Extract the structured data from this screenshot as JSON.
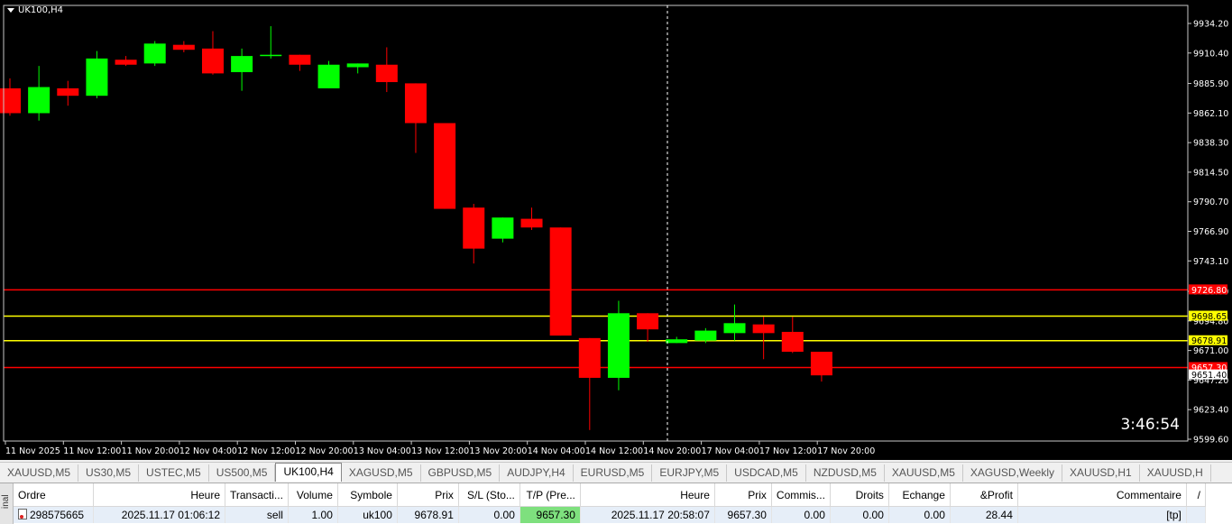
{
  "chart": {
    "symbol": "UK100,H4",
    "countdown": "3:46:54",
    "price_axis": [
      "9934.20",
      "9910.40",
      "9885.90",
      "9862.10",
      "9838.30",
      "9814.50",
      "9790.70",
      "9766.90",
      "9743.10",
      "9718.60",
      "9694.80",
      "9671.00",
      "9647.20",
      "9623.40",
      "9599.60"
    ],
    "price_labels": [
      {
        "price": 9719.8,
        "text": "9726.80",
        "bg": "#ff0000",
        "fg": "#ffffff",
        "color_line": "#ff0000"
      },
      {
        "price": 9698.65,
        "text": "9698.65",
        "bg": "#ffff00",
        "fg": "#000000",
        "color_line": "#ffff00"
      },
      {
        "price": 9678.91,
        "text": "9678.91",
        "bg": "#ffff00",
        "fg": "#000000",
        "color_line": "#ffff00"
      },
      {
        "price": 9657.3,
        "text": "9657.30",
        "bg": "#ff0000",
        "fg": "#ffffff",
        "color_line": "#ff0000"
      },
      {
        "price": 9651.4,
        "text": "9651.40",
        "bg": "#ffffff",
        "fg": "#000000",
        "color_line": ""
      }
    ],
    "time_axis": [
      "11 Nov 2025",
      "11 Nov 12:00",
      "11 Nov 20:00",
      "12 Nov 04:00",
      "12 Nov 12:00",
      "12 Nov 20:00",
      "13 Nov 04:00",
      "13 Nov 12:00",
      "13 Nov 20:00",
      "14 Nov 04:00",
      "14 Nov 12:00",
      "14 Nov 20:00",
      "17 Nov 04:00",
      "17 Nov 12:00",
      "17 Nov 20:00"
    ]
  },
  "chart_data": {
    "type": "candlestick",
    "ylim": [
      9595,
      9945
    ],
    "bull_color": "#00ff00",
    "bear_color": "#ff0000",
    "candles": [
      {
        "o": 9882,
        "h": 9890,
        "l": 9860,
        "c": 9862
      },
      {
        "o": 9862,
        "h": 9900,
        "l": 9856,
        "c": 9883
      },
      {
        "o": 9882,
        "h": 9888,
        "l": 9868,
        "c": 9876
      },
      {
        "o": 9876,
        "h": 9912,
        "l": 9874,
        "c": 9906
      },
      {
        "o": 9905,
        "h": 9908,
        "l": 9900,
        "c": 9901
      },
      {
        "o": 9902,
        "h": 9920,
        "l": 9900,
        "c": 9918
      },
      {
        "o": 9917,
        "h": 9920,
        "l": 9911,
        "c": 9913
      },
      {
        "o": 9914,
        "h": 9928,
        "l": 9893,
        "c": 9894
      },
      {
        "o": 9895,
        "h": 9914,
        "l": 9880,
        "c": 9908
      },
      {
        "o": 9908,
        "h": 9932,
        "l": 9906,
        "c": 9909
      },
      {
        "o": 9909,
        "h": 9909,
        "l": 9896,
        "c": 9901
      },
      {
        "o": 9882,
        "h": 9904,
        "l": 9882,
        "c": 9901
      },
      {
        "o": 9899,
        "h": 9902,
        "l": 9894,
        "c": 9902
      },
      {
        "o": 9901,
        "h": 9915,
        "l": 9879,
        "c": 9887
      },
      {
        "o": 9886,
        "h": 9886,
        "l": 9830,
        "c": 9854
      },
      {
        "o": 9854,
        "h": 9854,
        "l": 9785,
        "c": 9785
      },
      {
        "o": 9786,
        "h": 9789,
        "l": 9741,
        "c": 9753
      },
      {
        "o": 9761,
        "h": 9778,
        "l": 9758,
        "c": 9778
      },
      {
        "o": 9777,
        "h": 9786,
        "l": 9768,
        "c": 9770
      },
      {
        "o": 9770,
        "h": 9770,
        "l": 9683,
        "c": 9683
      },
      {
        "o": 9681,
        "h": 9681,
        "l": 9607,
        "c": 9649
      },
      {
        "o": 9649,
        "h": 9711,
        "l": 9639,
        "c": 9701
      },
      {
        "o": 9701,
        "h": 9701,
        "l": 9678,
        "c": 9688
      },
      {
        "o": 9677,
        "h": 9682,
        "l": 9677,
        "c": 9680
      },
      {
        "o": 9679,
        "h": 9689,
        "l": 9677,
        "c": 9687
      },
      {
        "o": 9685,
        "h": 9708,
        "l": 9679,
        "c": 9693
      },
      {
        "o": 9692,
        "h": 9698,
        "l": 9664,
        "c": 9685
      },
      {
        "o": 9686,
        "h": 9698,
        "l": 9669,
        "c": 9670
      },
      {
        "o": 9670,
        "h": 9670,
        "l": 9646,
        "c": 9651
      }
    ]
  },
  "tabs": [
    "XAUUSD,M5",
    "US30,M5",
    "USTEC,M5",
    "US500,M5",
    "UK100,H4",
    "XAGUSD,M5",
    "GBPUSD,M5",
    "AUDJPY,H4",
    "EURUSD,M5",
    "EURJPY,M5",
    "USDCAD,M5",
    "NZDUSD,M5",
    "XAUUSD,M5",
    "XAGUSD,Weekly",
    "XAUUSD,H1",
    "XAUUSD,H"
  ],
  "active_tab": 4,
  "terminal": {
    "side_label": "inal",
    "columns": [
      "Ordre",
      "Heure",
      "Transacti...",
      "Volume",
      "Symbole",
      "Prix",
      "S/L (Sto...",
      "T/P (Pre...",
      "Heure",
      "Prix",
      "Commis...",
      "Droits",
      "Echange",
      "&Profit",
      "Commentaire",
      "/"
    ],
    "row": {
      "order": "298575665",
      "time_open": "2025.11.17 01:06:12",
      "type": "sell",
      "volume": "1.00",
      "symbol": "uk100",
      "price_open": "9678.91",
      "sl": "0.00",
      "tp": "9657.30",
      "time_close": "2025.11.17 20:58:07",
      "price_close": "9657.30",
      "commission": "0.00",
      "fees": "0.00",
      "swap": "0.00",
      "profit": "28.44",
      "comment": "[tp]"
    }
  }
}
